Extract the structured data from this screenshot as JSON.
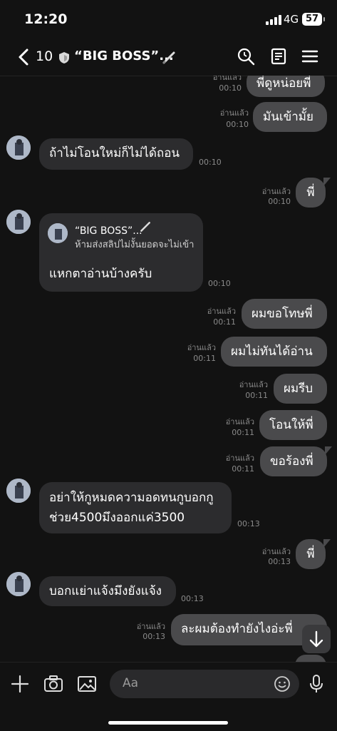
{
  "status": {
    "time": "12:20",
    "network": "4G",
    "battery": "57"
  },
  "header": {
    "back_count": "10",
    "title": "“BIG BOSS”..."
  },
  "messages": [
    {
      "side": "out",
      "text": "พี่ดูหน่อยพี่",
      "read": "อ่านแล้ว",
      "time": "00:10"
    },
    {
      "side": "out",
      "text": "มันเข้ามั้ย",
      "read": "อ่านแล้ว",
      "time": "00:10"
    },
    {
      "side": "in",
      "text": "ถ้าไม่โอนใหม่ก็ไม่ได้ถอน",
      "time": "00:10"
    },
    {
      "side": "out",
      "text": "พี่",
      "read": "อ่านแล้ว",
      "time": "00:10"
    },
    {
      "side": "in-reply",
      "reply_name": "“BIG BOSS”...",
      "reply_text": "ห้ามส่งสลิปไม่งั้นยอดจะไม่เข้า",
      "text": "แหกตาอ่านบ้างครับ",
      "time": "00:10"
    },
    {
      "side": "out",
      "text": "ผมขอโทษพี่",
      "read": "อ่านแล้ว",
      "time": "00:11"
    },
    {
      "side": "out",
      "text": "ผมไม่ทันได้อ่าน",
      "read": "อ่านแล้ว",
      "time": "00:11"
    },
    {
      "side": "out",
      "text": "ผมรีบ",
      "read": "อ่านแล้ว",
      "time": "00:11"
    },
    {
      "side": "out",
      "text": "โอนให้พี่",
      "read": "อ่านแล้ว",
      "time": "00:11"
    },
    {
      "side": "out",
      "text": "ขอร้องพี่",
      "read": "อ่านแล้ว",
      "time": "00:11"
    },
    {
      "side": "in",
      "line1": "อย่าให้กูหมดความอดทนกูบอกกู",
      "line2": "ช่วย4500มึงออกแค่3500",
      "time": "00:13"
    },
    {
      "side": "out",
      "text": "พี่",
      "read": "อ่านแล้ว",
      "time": "00:13"
    },
    {
      "side": "in",
      "text": "บอกแย่าแจ้งมึงยังแจ้ง",
      "time": "00:13"
    },
    {
      "side": "out",
      "text": "ละผมต้องทำยังไงอ่ะพี่",
      "read": "อ่านแล้ว",
      "time": "00:13"
    }
  ],
  "input": {
    "placeholder": "Aa"
  },
  "colors": {
    "background": "#121212",
    "incoming": "#2c2c2e",
    "outgoing": "#4a4a4c"
  },
  "icons": [
    "chevron-left-icon",
    "shield-icon",
    "pen-icon",
    "search-icon",
    "notes-icon",
    "menu-icon",
    "plus-icon",
    "camera-icon",
    "image-icon",
    "emoji-icon",
    "mic-icon",
    "arrow-down-icon"
  ]
}
